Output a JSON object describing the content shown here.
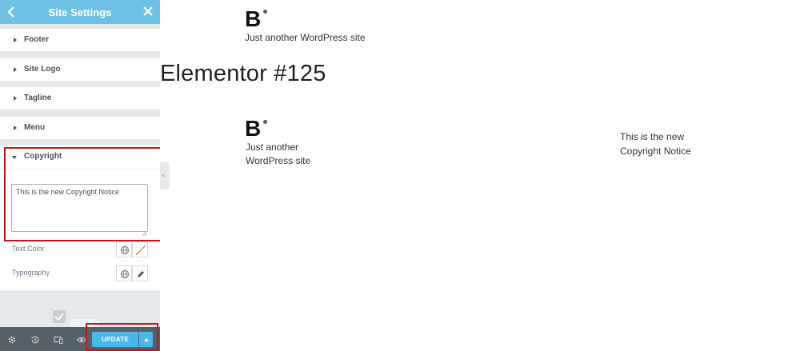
{
  "sidebar": {
    "title": "Site Settings",
    "sections": [
      {
        "label": "Footer"
      },
      {
        "label": "Site Logo"
      },
      {
        "label": "Tagline"
      },
      {
        "label": "Menu"
      }
    ],
    "copyright": {
      "label": "Copyright",
      "text_value": "This is the new Copyright Notice"
    },
    "controls": {
      "text_color_label": "Text Color",
      "typography_label": "Typography"
    },
    "footer": {
      "update_label": "UPDATE",
      "icons": [
        "settings-icon",
        "history-icon",
        "responsive-icon",
        "preview-icon"
      ]
    }
  },
  "preview": {
    "logo_letter": "B",
    "site_tagline": "Just another WordPress site",
    "page_heading": "Elementor #125",
    "footer_tagline_line1": "Just another",
    "footer_tagline_line2": "WordPress site",
    "copyright_line1": "This is the new",
    "copyright_line2": "Copyright Notice"
  },
  "colors": {
    "header": "#6ec1e4",
    "update_button": "#4ab7e8",
    "highlight": "#c3151b",
    "toolbar": "#556068"
  }
}
